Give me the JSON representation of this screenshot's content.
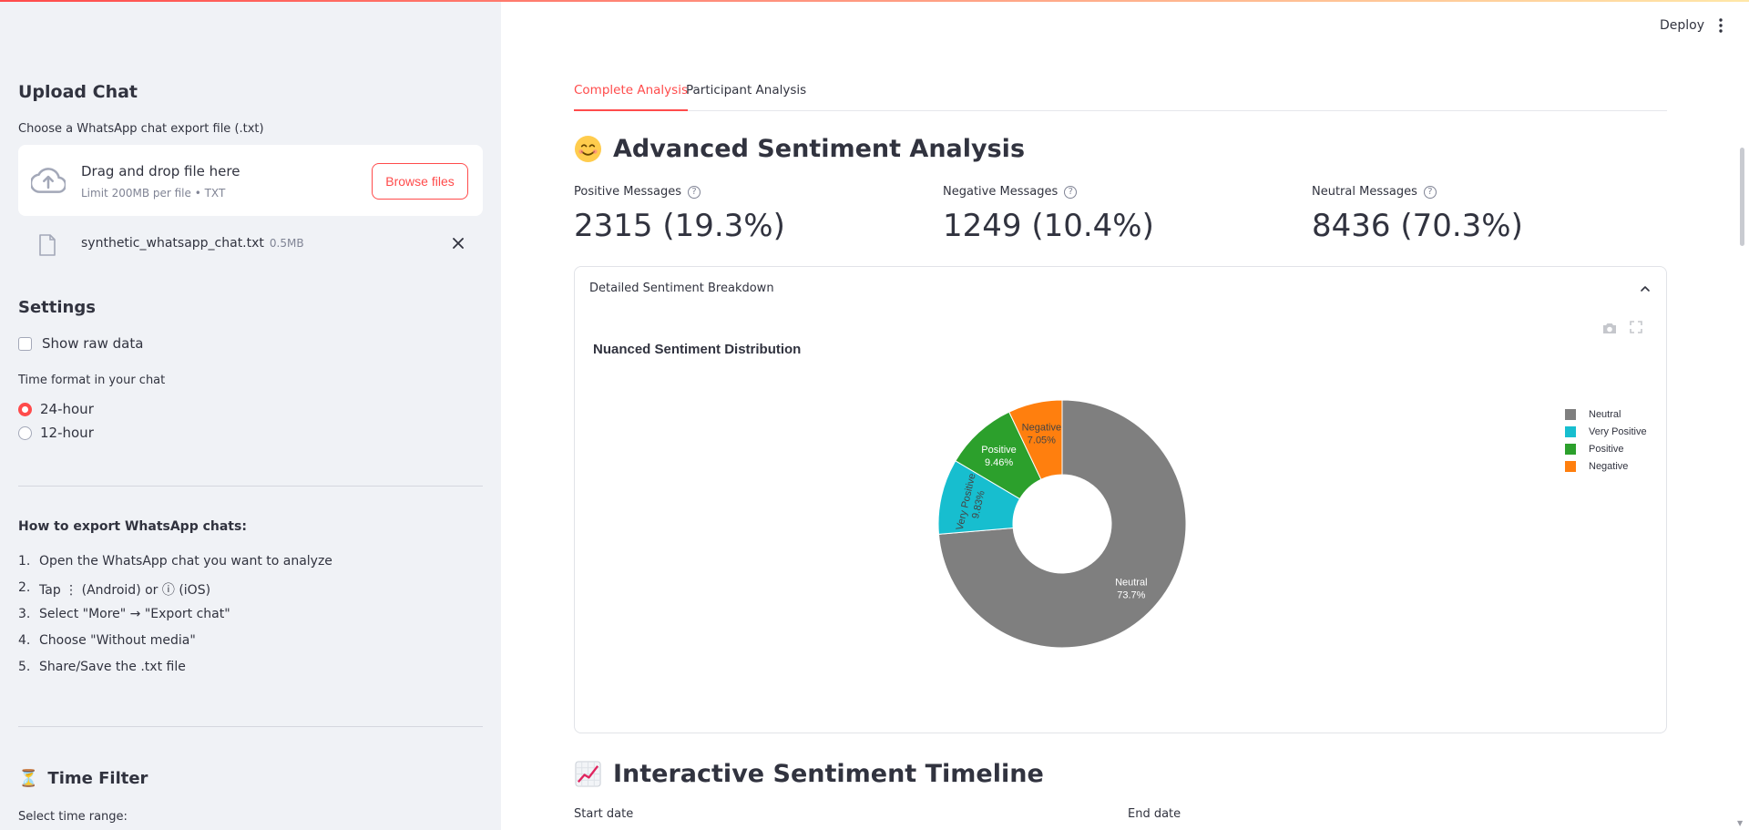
{
  "header": {
    "deploy_label": "Deploy",
    "menu_icon": "kebab-menu-icon"
  },
  "sidebar": {
    "upload_title": "Upload Chat",
    "upload_label": "Choose a WhatsApp chat export file (.txt)",
    "dropzone_title": "Drag and drop file here",
    "dropzone_sub": "Limit 200MB per file • TXT",
    "browse_label": "Browse files",
    "file_name": "synthetic_whatsapp_chat.txt",
    "file_size": "0.5MB",
    "settings_title": "Settings",
    "show_raw_label": "Show raw data",
    "time_format_label": "Time format in your chat",
    "radio_24": "24-hour",
    "radio_12": "12-hour",
    "how_title": "How to export WhatsApp chats:",
    "steps": [
      "Open the WhatsApp chat you want to analyze",
      "Tap ⋮ (Android) or ⓘ (iOS)",
      "Select \"More\" → \"Export chat\"",
      "Choose \"Without media\"",
      "Share/Save the .txt file"
    ],
    "time_filter_title": "Time Filter",
    "time_filter_icon": "⏳",
    "select_range_label": "Select time range:"
  },
  "tabs": [
    {
      "label": "Complete Analysis",
      "active": true
    },
    {
      "label": "Participant Analysis",
      "active": false
    }
  ],
  "sentiment": {
    "title": "Advanced Sentiment Analysis",
    "metrics": [
      {
        "label": "Positive Messages",
        "value": "2315 (19.3%)"
      },
      {
        "label": "Negative Messages",
        "value": "1249 (10.4%)"
      },
      {
        "label": "Neutral Messages",
        "value": "8436 (70.3%)"
      }
    ],
    "expander_title": "Detailed Sentiment Breakdown"
  },
  "timeline": {
    "title": "Interactive Sentiment Timeline",
    "start_label": "Start date",
    "end_label": "End date"
  },
  "chart_data": {
    "type": "pie",
    "title": "Nuanced Sentiment Distribution",
    "hole": true,
    "categories": [
      "Neutral",
      "Very Positive",
      "Positive",
      "Negative"
    ],
    "values": [
      73.7,
      9.83,
      9.46,
      7.05
    ],
    "labels": [
      "73.7%",
      "9.83%",
      "9.46%",
      "7.05%"
    ],
    "colors": [
      "#7f7f7f",
      "#17becf",
      "#2ca02c",
      "#ff7f0e"
    ],
    "legend_position": "top-right"
  },
  "colors": {
    "accent": "#ff4b4b",
    "sidebar_bg": "#f0f2f6"
  }
}
